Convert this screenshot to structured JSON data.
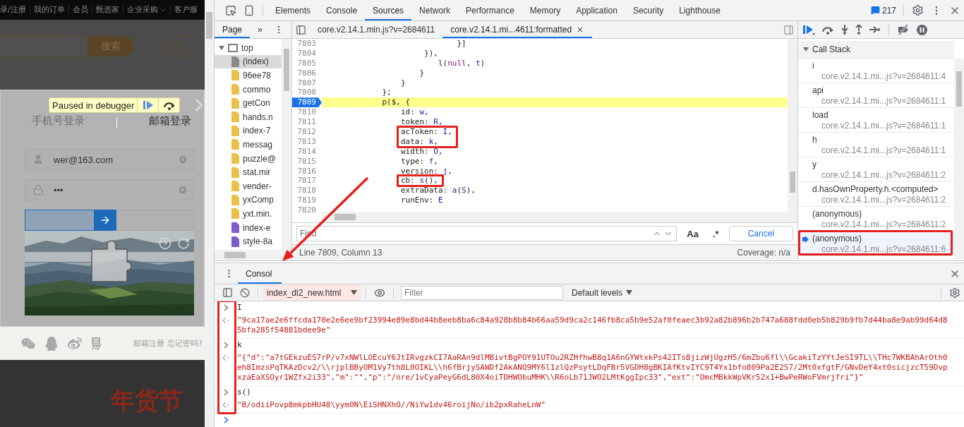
{
  "page": {
    "nav": [
      "录/注册",
      "我的订单",
      "会员",
      "甄选家",
      "企业采购",
      "客户服"
    ],
    "search_button": "搜索",
    "login": {
      "paused_label": "Paused in debugger",
      "tabs": [
        {
          "label": "手机号登录",
          "selected": false
        },
        {
          "label": "邮箱登录",
          "selected": true
        }
      ],
      "email": "wer@163.com",
      "password": "•••",
      "captcha": {
        "level": 0.41,
        "kind": "picture"
      },
      "links": [
        "邮箱注册",
        "忘记密码?"
      ]
    },
    "banners": [
      "年货节"
    ]
  },
  "devtools": {
    "tabs": [
      {
        "label": "Elements",
        "selected": false
      },
      {
        "label": "Console",
        "selected": false
      },
      {
        "label": "Sources",
        "selected": true
      },
      {
        "label": "Network",
        "selected": false
      },
      {
        "label": "Performance",
        "selected": false
      },
      {
        "label": "Memory",
        "selected": false
      },
      {
        "label": "Application",
        "selected": false
      },
      {
        "label": "Security",
        "selected": false
      },
      {
        "label": "Lighthouse",
        "selected": false
      }
    ],
    "issues_count": "217",
    "navigator": {
      "tab": {
        "label": "Page",
        "selected": true
      },
      "more": "»",
      "items": [
        {
          "label": "top",
          "kind": "frame",
          "expanded": true,
          "selected": false,
          "children": [
            {
              "label": "(index)",
              "kind": "document",
              "selected": true
            },
            {
              "label": "96ee78",
              "kind": "script",
              "selected": false
            },
            {
              "label": "commo",
              "kind": "script",
              "selected": false
            },
            {
              "label": "getCon",
              "kind": "script",
              "selected": false
            },
            {
              "label": "hands.n",
              "kind": "script",
              "selected": false
            },
            {
              "label": "index-7",
              "kind": "script",
              "selected": false
            },
            {
              "label": "messag",
              "kind": "script",
              "selected": false
            },
            {
              "label": "puzzle@",
              "kind": "script",
              "selected": false
            },
            {
              "label": "stat.mir",
              "kind": "script",
              "selected": false
            },
            {
              "label": "vender-",
              "kind": "script",
              "selected": false
            },
            {
              "label": "yxComp",
              "kind": "script",
              "selected": false
            },
            {
              "label": "yxt.min.",
              "kind": "script",
              "selected": false
            },
            {
              "label": "index-e",
              "kind": "stylesheet",
              "selected": false
            },
            {
              "label": "style-8a",
              "kind": "stylesheet",
              "selected": false
            }
          ]
        }
      ]
    },
    "editor": {
      "tabs": [
        {
          "label": "core.v2.14.1.min.js?v=2684611",
          "selected": false,
          "closable": false
        },
        {
          "label": "core.v2.14.1.mi...4611:formatted",
          "selected": true,
          "closable": true
        }
      ],
      "lines": [
        {
          "number": "7803",
          "current": false,
          "boxed": false,
          "code": [
            {
              "text": "                            }]",
              "kind": "plain"
            }
          ]
        },
        {
          "number": "7804",
          "current": false,
          "boxed": false,
          "code": [
            {
              "text": "                     }),",
              "kind": "plain"
            }
          ]
        },
        {
          "number": "7805",
          "current": false,
          "boxed": false,
          "code": [
            {
              "text": "                        l(",
              "kind": "plain"
            },
            {
              "text": "null",
              "kind": "keyword"
            },
            {
              "text": ", ",
              "kind": "plain"
            },
            {
              "text": "t",
              "kind": "value"
            },
            {
              "text": ")",
              "kind": "plain"
            }
          ]
        },
        {
          "number": "7806",
          "current": false,
          "boxed": false,
          "code": [
            {
              "text": "                    }",
              "kind": "plain"
            }
          ]
        },
        {
          "number": "7807",
          "current": false,
          "boxed": false,
          "code": [
            {
              "text": "                }",
              "kind": "plain"
            }
          ]
        },
        {
          "number": "7808",
          "current": false,
          "boxed": false,
          "code": [
            {
              "text": "            };",
              "kind": "plain"
            }
          ]
        },
        {
          "number": "7809",
          "current": true,
          "boxed": false,
          "code": [
            {
              "text": "            p($, {",
              "kind": "plain"
            }
          ]
        },
        {
          "number": "7810",
          "current": false,
          "boxed": false,
          "code": [
            {
              "text": "                id: ",
              "kind": "plain"
            },
            {
              "text": "w",
              "kind": "value"
            },
            {
              "text": ",",
              "kind": "plain"
            }
          ]
        },
        {
          "number": "7811",
          "current": false,
          "boxed": false,
          "code": [
            {
              "text": "                token: ",
              "kind": "plain"
            },
            {
              "text": "R",
              "kind": "value"
            },
            {
              "text": ",",
              "kind": "plain"
            }
          ]
        },
        {
          "number": "7812",
          "current": false,
          "boxed": true,
          "code": [
            {
              "text": "                acToken: ",
              "kind": "plain"
            },
            {
              "text": "I",
              "kind": "value"
            },
            {
              "text": ",",
              "kind": "plain"
            }
          ]
        },
        {
          "number": "7813",
          "current": false,
          "boxed": true,
          "code": [
            {
              "text": "                data: ",
              "kind": "plain"
            },
            {
              "text": "k",
              "kind": "value"
            },
            {
              "text": ",",
              "kind": "plain"
            }
          ]
        },
        {
          "number": "7814",
          "current": false,
          "boxed": false,
          "code": [
            {
              "text": "                width: ",
              "kind": "plain"
            },
            {
              "text": "O",
              "kind": "value"
            },
            {
              "text": ",",
              "kind": "plain"
            }
          ]
        },
        {
          "number": "7815",
          "current": false,
          "boxed": false,
          "code": [
            {
              "text": "                type: ",
              "kind": "plain"
            },
            {
              "text": "f",
              "kind": "value"
            },
            {
              "text": ",",
              "kind": "plain"
            }
          ]
        },
        {
          "number": "7816",
          "current": false,
          "boxed": false,
          "code": [
            {
              "text": "                version: ",
              "kind": "plain"
            },
            {
              "text": "j",
              "kind": "value"
            },
            {
              "text": ",",
              "kind": "plain"
            }
          ]
        },
        {
          "number": "7817",
          "current": false,
          "boxed": true,
          "code": [
            {
              "text": "                cb: ",
              "kind": "plain"
            },
            {
              "text": "s",
              "kind": "value"
            },
            {
              "text": "(),",
              "kind": "plain"
            }
          ]
        },
        {
          "number": "7818",
          "current": false,
          "boxed": false,
          "code": [
            {
              "text": "                extraData: ",
              "kind": "plain"
            },
            {
              "text": "a",
              "kind": "value"
            },
            {
              "text": "(",
              "kind": "plain"
            },
            {
              "text": "S",
              "kind": "value"
            },
            {
              "text": "),",
              "kind": "plain"
            }
          ]
        },
        {
          "number": "7819",
          "current": false,
          "boxed": false,
          "code": [
            {
              "text": "                runEnv: ",
              "kind": "plain"
            },
            {
              "text": "E",
              "kind": "value"
            }
          ]
        },
        {
          "number": "7820",
          "current": false,
          "boxed": false
        }
      ],
      "find": {
        "placeholder": "Find",
        "case_label": "Aa",
        "regex_label": ".*",
        "cancel": "Cancel"
      },
      "status": "Line 7809, Column 13",
      "coverage": "Coverage: n/a"
    },
    "call_stack": {
      "title": "Call Stack",
      "expanded": true,
      "frames": [
        {
          "name": "i",
          "location": "core.v2.14.1.mi...js?v=2684611:4",
          "selected": false,
          "boxed": false
        },
        {
          "name": "api",
          "location": "core.v2.14.1.mi...js?v=2684611:1",
          "selected": false,
          "boxed": false
        },
        {
          "name": "load",
          "location": "core.v2.14.1.mi...js?v=2684611:1",
          "selected": false,
          "boxed": false
        },
        {
          "name": "h",
          "location": "core.v2.14.1.mi...js?v=2684611:1",
          "selected": false,
          "boxed": false
        },
        {
          "name": "y",
          "location": "core.v2.14.1.mi...js?v=2684611:2",
          "selected": false,
          "boxed": false
        },
        {
          "name": "d.hasOwnProperty.h.<computed>",
          "location": "core.v2.14.1.mi...js?v=2684611:2",
          "selected": false,
          "boxed": false
        },
        {
          "name": "(anonymous)",
          "location": "core.v2.14.1.mi...js?v=2684611:2",
          "selected": false,
          "boxed": false
        },
        {
          "name": "(anonymous)",
          "location": "core.v2.14.1.mi...js?v=2684611:6",
          "selected": true,
          "boxed": true
        }
      ]
    },
    "console": {
      "tab": {
        "label": "Consol",
        "selected": true
      },
      "context": "index_dl2_new.html",
      "filter_placeholder": "Filter",
      "levels": "Default levels",
      "messages": [
        {
          "kind": "input",
          "text": "I"
        },
        {
          "kind": "output",
          "text": "\"9ca17ae2e6ffcda170e2e6ee9bf23994e89e8bd44b8eeb8ba6c84a928b8b84b66aa59d9ca2c146fb8ca5b9e52af0feaec3b92a82b896b2b747a688fdd0eb5b829b9fb7d44ba8e9ab99d64d85bfa285f54881bdee9e\""
        },
        {
          "kind": "input",
          "text": "k"
        },
        {
          "kind": "output",
          "text": "\"{\"d\":\"a7tGEkzuES7rP/v7xNWlLOEcuY6JtIRvgzkCI7AaRAn9dlMBivtBgPOY91UTOu2RZHfhwB8q1A6nGYWtxkPs42ITs8jizWjUgzH5/6mZbu6fl\\\\GcakiTzYYtJeSI9TL\\\\THc7WKBAhArOth0eh8ImzsPqTKAzDcv2/\\\\rjplBByOM1Vy7th8L0OIKL\\\\h6fBrjySAWDf2AkANQ9MY6l1zlQzPsytLDqFBr5VGDH8gBKIAfKtvIYC9T4Yx1bfo809Pa2E2S7/2Mt0xfgtF/GNvDeY4xt0sicjzcT59DvpxzaEaXSOyr1WZfx2i33\",\"m\":\"\",\"p\":\"/nre/1vCyaPeyG6dL80X4oiTDHWObuMHK\\\\R6oLb71JWO2LMtKggIpc33\",\"ext\":\"OmcMBkkWpVKr52x1+BwPeRWoFVmrjfri\"}\""
        },
        {
          "kind": "input",
          "text": "s()"
        },
        {
          "kind": "output",
          "text": "\"B/odiiPovp8mkpbHU48\\yym0N\\EiSHNXhO//NiYw1dv46roijNo/ib2pxRaheLnW\""
        },
        {
          "kind": "prompt"
        }
      ]
    }
  }
}
